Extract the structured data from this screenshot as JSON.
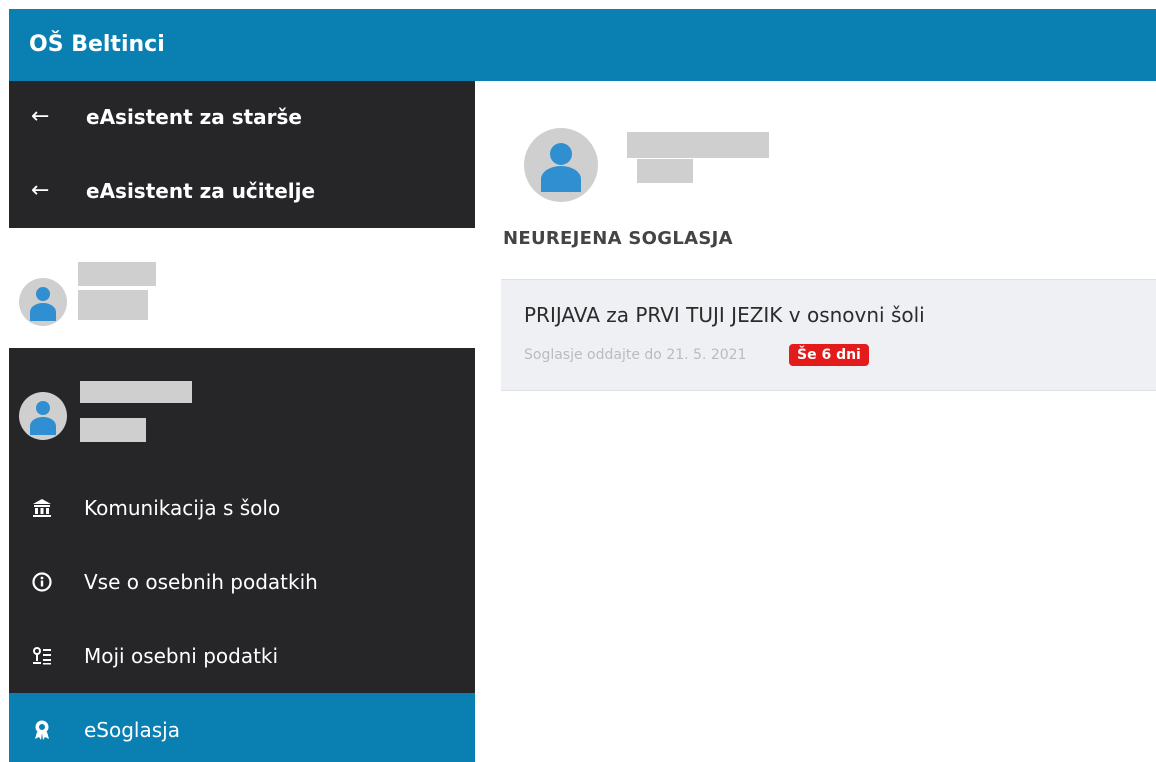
{
  "app": {
    "school_name": "OŠ Beltinci"
  },
  "sidebar": {
    "links": [
      {
        "label": "eAsistent za starše",
        "icon": "arrow-left-icon"
      },
      {
        "label": "eAsistent za učitelje",
        "icon": "arrow-left-icon"
      }
    ],
    "nav_items": [
      {
        "label": "Komunikacija s šolo",
        "icon": "bank-icon"
      },
      {
        "label": "Vse o osebnih podatkih",
        "icon": "info-circle-icon"
      },
      {
        "label": "Moji osebni podatki",
        "icon": "person-list-icon"
      },
      {
        "label": "eSoglasja",
        "icon": "award-icon",
        "active": true
      }
    ]
  },
  "main": {
    "section_title": "NEUREJENA SOGLASJA",
    "consents": [
      {
        "title": "PRIJAVA za PRVI TUJI JEZIK v osnovni šoli",
        "deadline": "Soglasje oddajte do 21. 5. 2021",
        "badge": "Še 6 dni"
      }
    ]
  },
  "colors": {
    "primary": "#0a7fb2",
    "sidebar_dark": "#262628",
    "badge_red": "#e31b1b",
    "card_bg": "#eef0f3"
  }
}
